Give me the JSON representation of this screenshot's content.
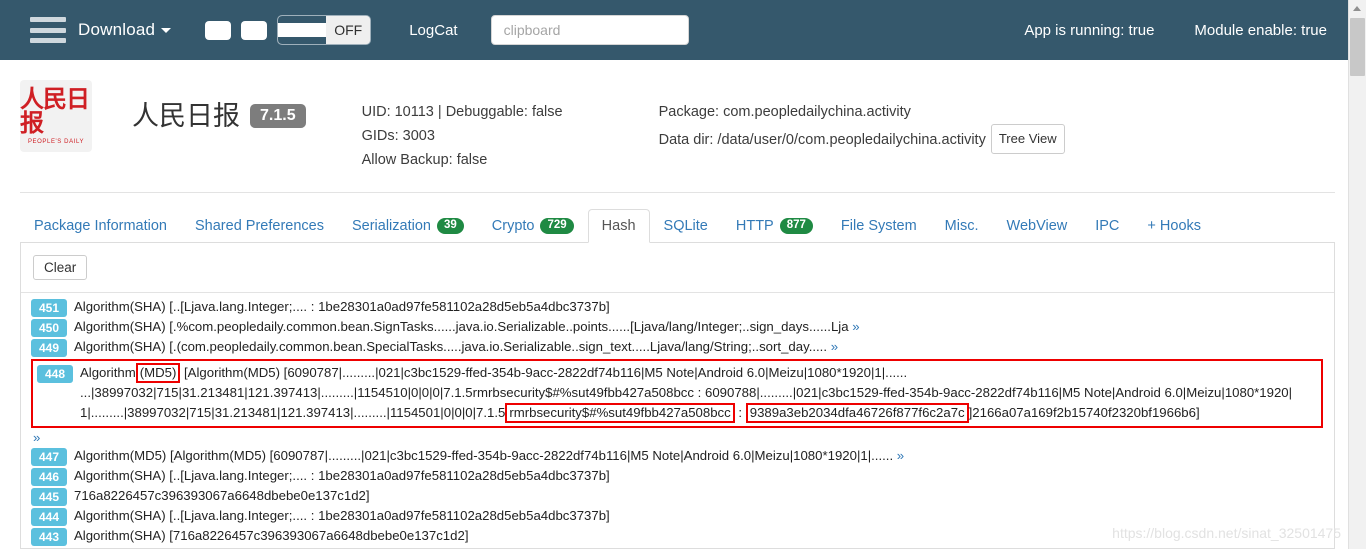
{
  "navbar": {
    "brand": "Download",
    "menu_icon": "hamburger-icon",
    "toggle_label": "OFF",
    "logcat": "LogCat",
    "clipboard_placeholder": "clipboard",
    "app_running": "App is running: true",
    "module_enable": "Module enable: true"
  },
  "app": {
    "icon_cn": "人民日报",
    "icon_en": "PEOPLE'S DAILY",
    "name": "人民日报",
    "version": "7.1.5",
    "uid_line": "UID: 10113 | Debuggable: false",
    "gids_line": "GIDs: 3003",
    "backup_line": "Allow Backup: false",
    "package_line": "Package: com.peopledailychina.activity",
    "data_dir_line": "Data dir: /data/user/0/com.peopledailychina.activity",
    "tree_view": "Tree View"
  },
  "tabs": [
    {
      "label": "Package Information",
      "count": "",
      "active": false
    },
    {
      "label": "Shared Preferences",
      "count": "",
      "active": false
    },
    {
      "label": "Serialization",
      "count": "39",
      "active": false
    },
    {
      "label": "Crypto",
      "count": "729",
      "active": false
    },
    {
      "label": "Hash",
      "count": "",
      "active": true
    },
    {
      "label": "SQLite",
      "count": "",
      "active": false
    },
    {
      "label": "HTTP",
      "count": "877",
      "active": false
    },
    {
      "label": "File System",
      "count": "",
      "active": false
    },
    {
      "label": "Misc.",
      "count": "",
      "active": false
    },
    {
      "label": "WebView",
      "count": "",
      "active": false
    },
    {
      "label": "IPC",
      "count": "",
      "active": false
    },
    {
      "label": "+ Hooks",
      "count": "",
      "active": false
    }
  ],
  "panel": {
    "clear_label": "Clear",
    "logs": [
      {
        "num": "451",
        "text": "Algorithm(SHA) [..[Ljava.lang.Integer;.... : 1be28301a0ad97fe581102a28d5eb5a4dbc3737b]",
        "more": ""
      },
      {
        "num": "450",
        "text": "Algorithm(SHA) [.%com.peopledaily.common.bean.SignTasks......java.io.Serializable..points......[Ljava/lang/Integer;..sign_days......Lja",
        "more": "»"
      },
      {
        "num": "449",
        "text": "Algorithm(SHA) [.(com.peopledaily.common.bean.SpecialTasks.....java.io.Serializable..sign_text.....Ljava/lang/String;..sort_day.....",
        "more": "»"
      }
    ],
    "highlighted": {
      "num": "448",
      "seg1_prefix": "Algorithm",
      "seg1_boxed": "(MD5)",
      "seg1_suffix": " [Algorithm(MD5) [6090787|.........|021|c3bc1529-ffed-354b-9acc-2822df74b116|M5 Note|Android 6.0|Meizu|1080*1920|1|......",
      "line2": "...|38997032|715|31.213481|121.397413|.........|1154510|0|0|0|7.1.5rmrbsecurity$#%sut49fbb427a508bcc : 6090788|.........|021|c3bc1529-ffed-354b-9acc-2822df74b116|M5 Note|Android 6.0|Meizu|1080*1920|",
      "line3_prefix": "1|.........|38997032|715|31.213481|121.397413|.........|1154501|0|0|0|7.1.5",
      "line3_boxed_a": "rmrbsecurity$#%sut49fbb427a508bcc",
      "line3_mid": " : ",
      "line3_boxed_b": "9389a3eb2034dfa46726f877f6c2a7c",
      "line3_suffix": "]2166a07a169f2b15740f2320bf1966b6]",
      "chevron": "»"
    },
    "logs_after": [
      {
        "num": "447",
        "text": "Algorithm(MD5) [Algorithm(MD5) [6090787|.........|021|c3bc1529-ffed-354b-9acc-2822df74b116|M5 Note|Android 6.0|Meizu|1080*1920|1|......",
        "more": "»"
      },
      {
        "num": "446",
        "text": "Algorithm(SHA) [..[Ljava.lang.Integer;.... : 1be28301a0ad97fe581102a28d5eb5a4dbc3737b]",
        "more": ""
      },
      {
        "num": "445",
        "text": "716a8226457c396393067a6648dbebe0e137c1d2]",
        "more": ""
      },
      {
        "num": "444",
        "text": "Algorithm(SHA) [..[Ljava.lang.Integer;.... : 1be28301a0ad97fe581102a28d5eb5a4dbc3737b]",
        "more": ""
      },
      {
        "num": "443",
        "text": "Algorithm(SHA) [716a8226457c396393067a6648dbebe0e137c1d2]",
        "more": ""
      }
    ]
  },
  "watermark": "https://blog.csdn.net/sinat_32501475",
  "colors": {
    "navbar": "#35586c",
    "link": "#337ab7",
    "badge_green": "#1f8a43",
    "badge_blue": "#5bc0de",
    "highlight_red": "#ee0000"
  }
}
